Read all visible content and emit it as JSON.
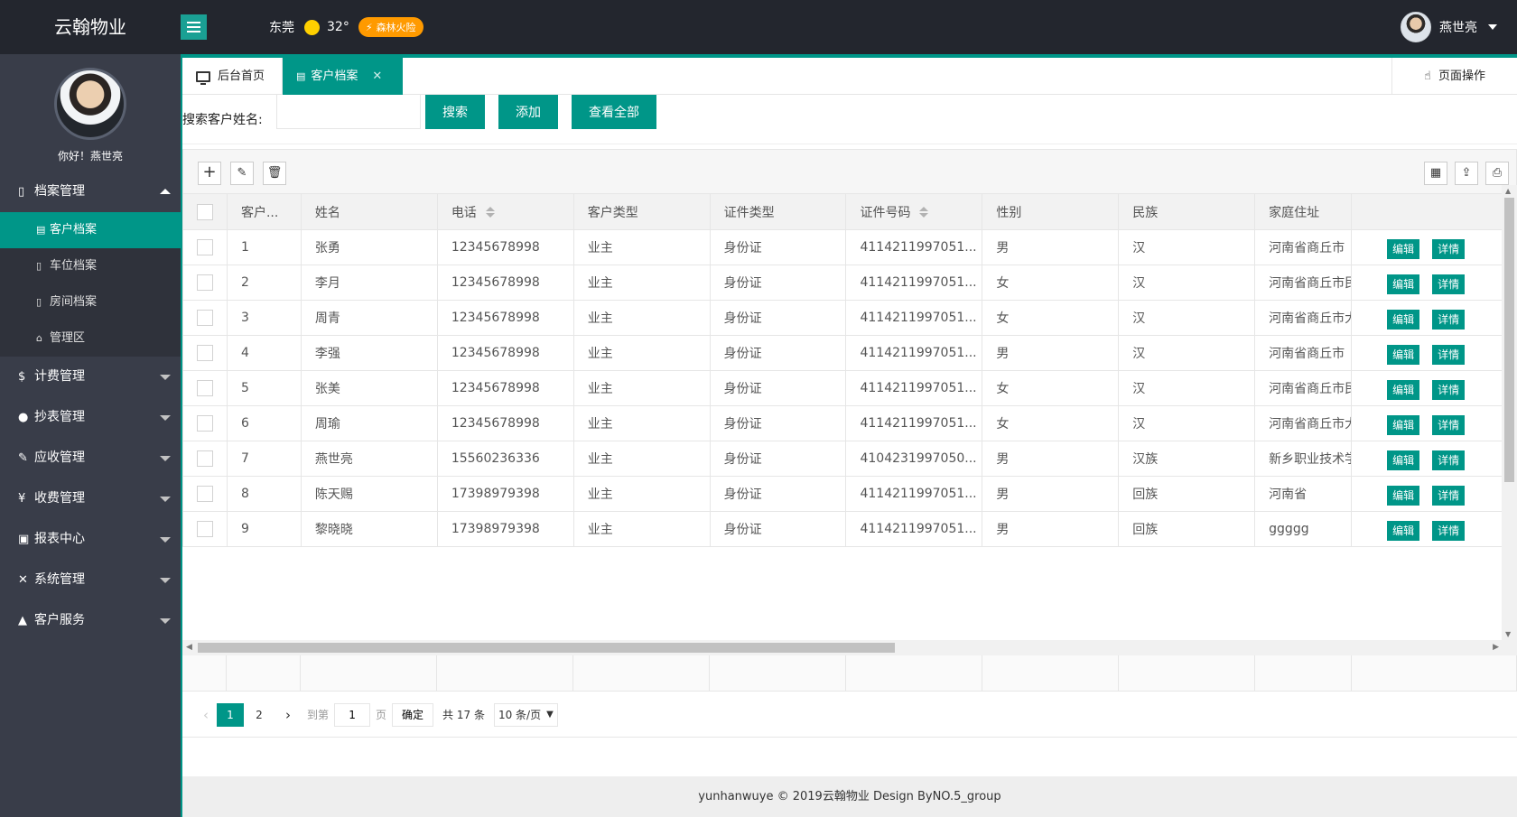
{
  "app": {
    "title": "云翰物业"
  },
  "header": {
    "city": "东莞",
    "temperature": "32°",
    "warning": "森林火险",
    "user": "燕世亮"
  },
  "sidebar": {
    "greeting": "你好！燕世亮",
    "groups": [
      {
        "label": "档案管理",
        "icon": "file-icon",
        "expanded": true,
        "items": [
          {
            "label": "客户档案",
            "active": true
          },
          {
            "label": "车位档案"
          },
          {
            "label": "房间档案"
          },
          {
            "label": "管理区"
          }
        ]
      },
      {
        "label": "计费管理",
        "icon": "dollar-icon"
      },
      {
        "label": "抄表管理",
        "icon": "meter-icon"
      },
      {
        "label": "应收管理",
        "icon": "receivable-icon"
      },
      {
        "label": "收费管理",
        "icon": "yen-icon"
      },
      {
        "label": "报表中心",
        "icon": "report-icon"
      },
      {
        "label": "系统管理",
        "icon": "system-icon"
      },
      {
        "label": "客户服务",
        "icon": "user-icon"
      }
    ]
  },
  "tabs": {
    "home": "后台首页",
    "current": "客户档案",
    "page_ops": "页面操作"
  },
  "search": {
    "label": "搜索客户姓名:",
    "value": "",
    "search_btn": "搜索",
    "add_btn": "添加",
    "all_btn": "查看全部"
  },
  "table": {
    "headers": [
      "客户...",
      "姓名",
      "电话",
      "客户类型",
      "证件类型",
      "证件号码",
      "性别",
      "民族",
      "家庭住址"
    ],
    "rows": [
      [
        "1",
        "张勇",
        "12345678998",
        "业主",
        "身份证",
        "4114211997051...",
        "男",
        "汉",
        "河南省商丘市"
      ],
      [
        "2",
        "李月",
        "12345678998",
        "业主",
        "身份证",
        "4114211997051...",
        "女",
        "汉",
        "河南省商丘市民"
      ],
      [
        "3",
        "周青",
        "12345678998",
        "业主",
        "身份证",
        "4114211997051...",
        "女",
        "汉",
        "河南省商丘市大"
      ],
      [
        "4",
        "李强",
        "12345678998",
        "业主",
        "身份证",
        "4114211997051...",
        "男",
        "汉",
        "河南省商丘市"
      ],
      [
        "5",
        "张美",
        "12345678998",
        "业主",
        "身份证",
        "4114211997051...",
        "女",
        "汉",
        "河南省商丘市民"
      ],
      [
        "6",
        "周瑜",
        "12345678998",
        "业主",
        "身份证",
        "4114211997051...",
        "女",
        "汉",
        "河南省商丘市大"
      ],
      [
        "7",
        "燕世亮",
        "15560236336",
        "业主",
        "身份证",
        "4104231997050...",
        "男",
        "汉族",
        "新乡职业技术学"
      ],
      [
        "8",
        "陈天赐",
        "17398979398",
        "业主",
        "身份证",
        "4114211997051...",
        "男",
        "回族",
        "河南省"
      ],
      [
        "9",
        "黎晓晓",
        "17398979398",
        "业主",
        "身份证",
        "4114211997051...",
        "男",
        "回族",
        "ggggg"
      ]
    ],
    "edit_label": "编辑",
    "detail_label": "详情"
  },
  "pager": {
    "pages": [
      "1",
      "2"
    ],
    "goto_label": "到第",
    "goto_value": "1",
    "page_label": "页",
    "confirm": "确定",
    "total": "共 17 条",
    "page_size": "10 条/页"
  },
  "footer": {
    "text": "yunhanwuye © 2019云翰物业 Design ByNO.5_group"
  },
  "colors": {
    "accent": "#009688",
    "header": "#23262e",
    "sidebar": "#393d49",
    "warning": "#ff9a00"
  }
}
